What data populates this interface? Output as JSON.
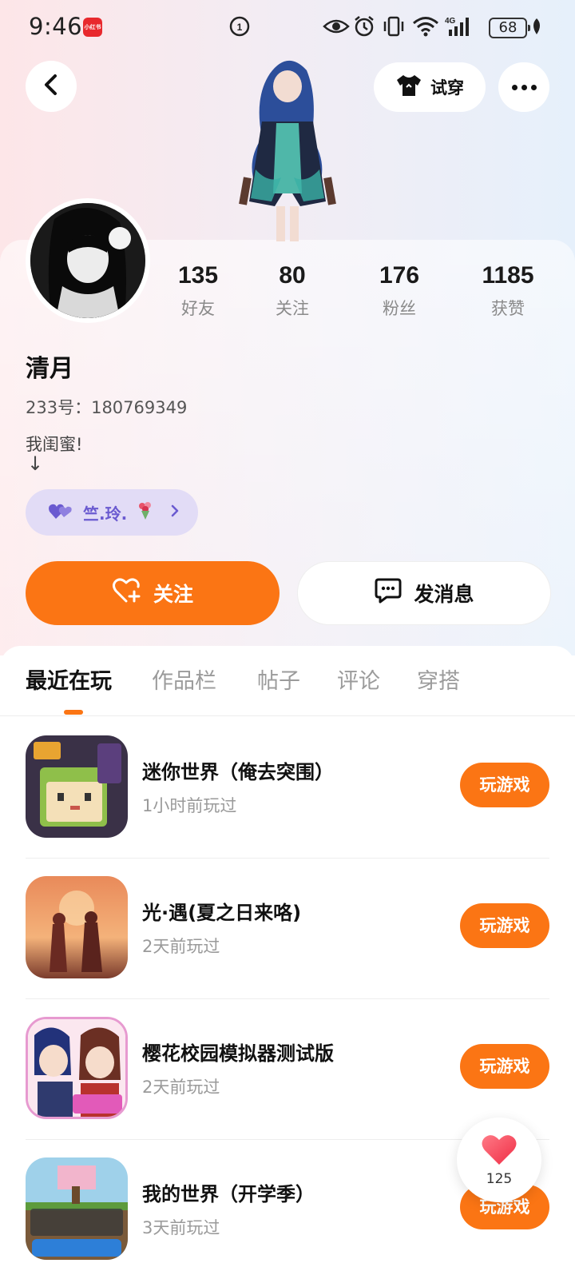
{
  "status_bar": {
    "time": "9:46",
    "app_badge": "小红书",
    "battery": "68",
    "network": "4G"
  },
  "header": {
    "back_icon": "chevron-left-icon",
    "try_on_label": "试穿",
    "more_icon": "more-dots-icon"
  },
  "profile": {
    "stats": [
      {
        "value": "135",
        "label": "好友"
      },
      {
        "value": "80",
        "label": "关注"
      },
      {
        "value": "176",
        "label": "粉丝"
      },
      {
        "value": "1185",
        "label": "获赞"
      }
    ],
    "name": "清月",
    "uid": "233号：180769349",
    "bio_line1": "我闺蜜!",
    "bio_line2": "↓",
    "relation_name": "竺.玲."
  },
  "actions": {
    "follow_label": "关注",
    "message_label": "发消息"
  },
  "tabs": [
    {
      "label": "最近在玩",
      "active": true
    },
    {
      "label": "作品栏",
      "active": false
    },
    {
      "label": "帖子",
      "active": false
    },
    {
      "label": "评论",
      "active": false
    },
    {
      "label": "穿搭",
      "active": false
    }
  ],
  "games": [
    {
      "title": "迷你世界（俺去突围）",
      "time": "1小时前玩过",
      "button": "玩游戏"
    },
    {
      "title": "光·遇(夏之日来咯)",
      "time": "2天前玩过",
      "button": "玩游戏"
    },
    {
      "title": "樱花校园模拟器测试版",
      "time": "2天前玩过",
      "button": "玩游戏"
    },
    {
      "title": "我的世界（开学季）",
      "time": "3天前玩过",
      "button": "玩游戏"
    }
  ],
  "floating_like": {
    "count": "125"
  },
  "colors": {
    "accent": "#fb7514",
    "chip_bg": "#e2dcf6",
    "chip_text": "#6a5ad0"
  }
}
